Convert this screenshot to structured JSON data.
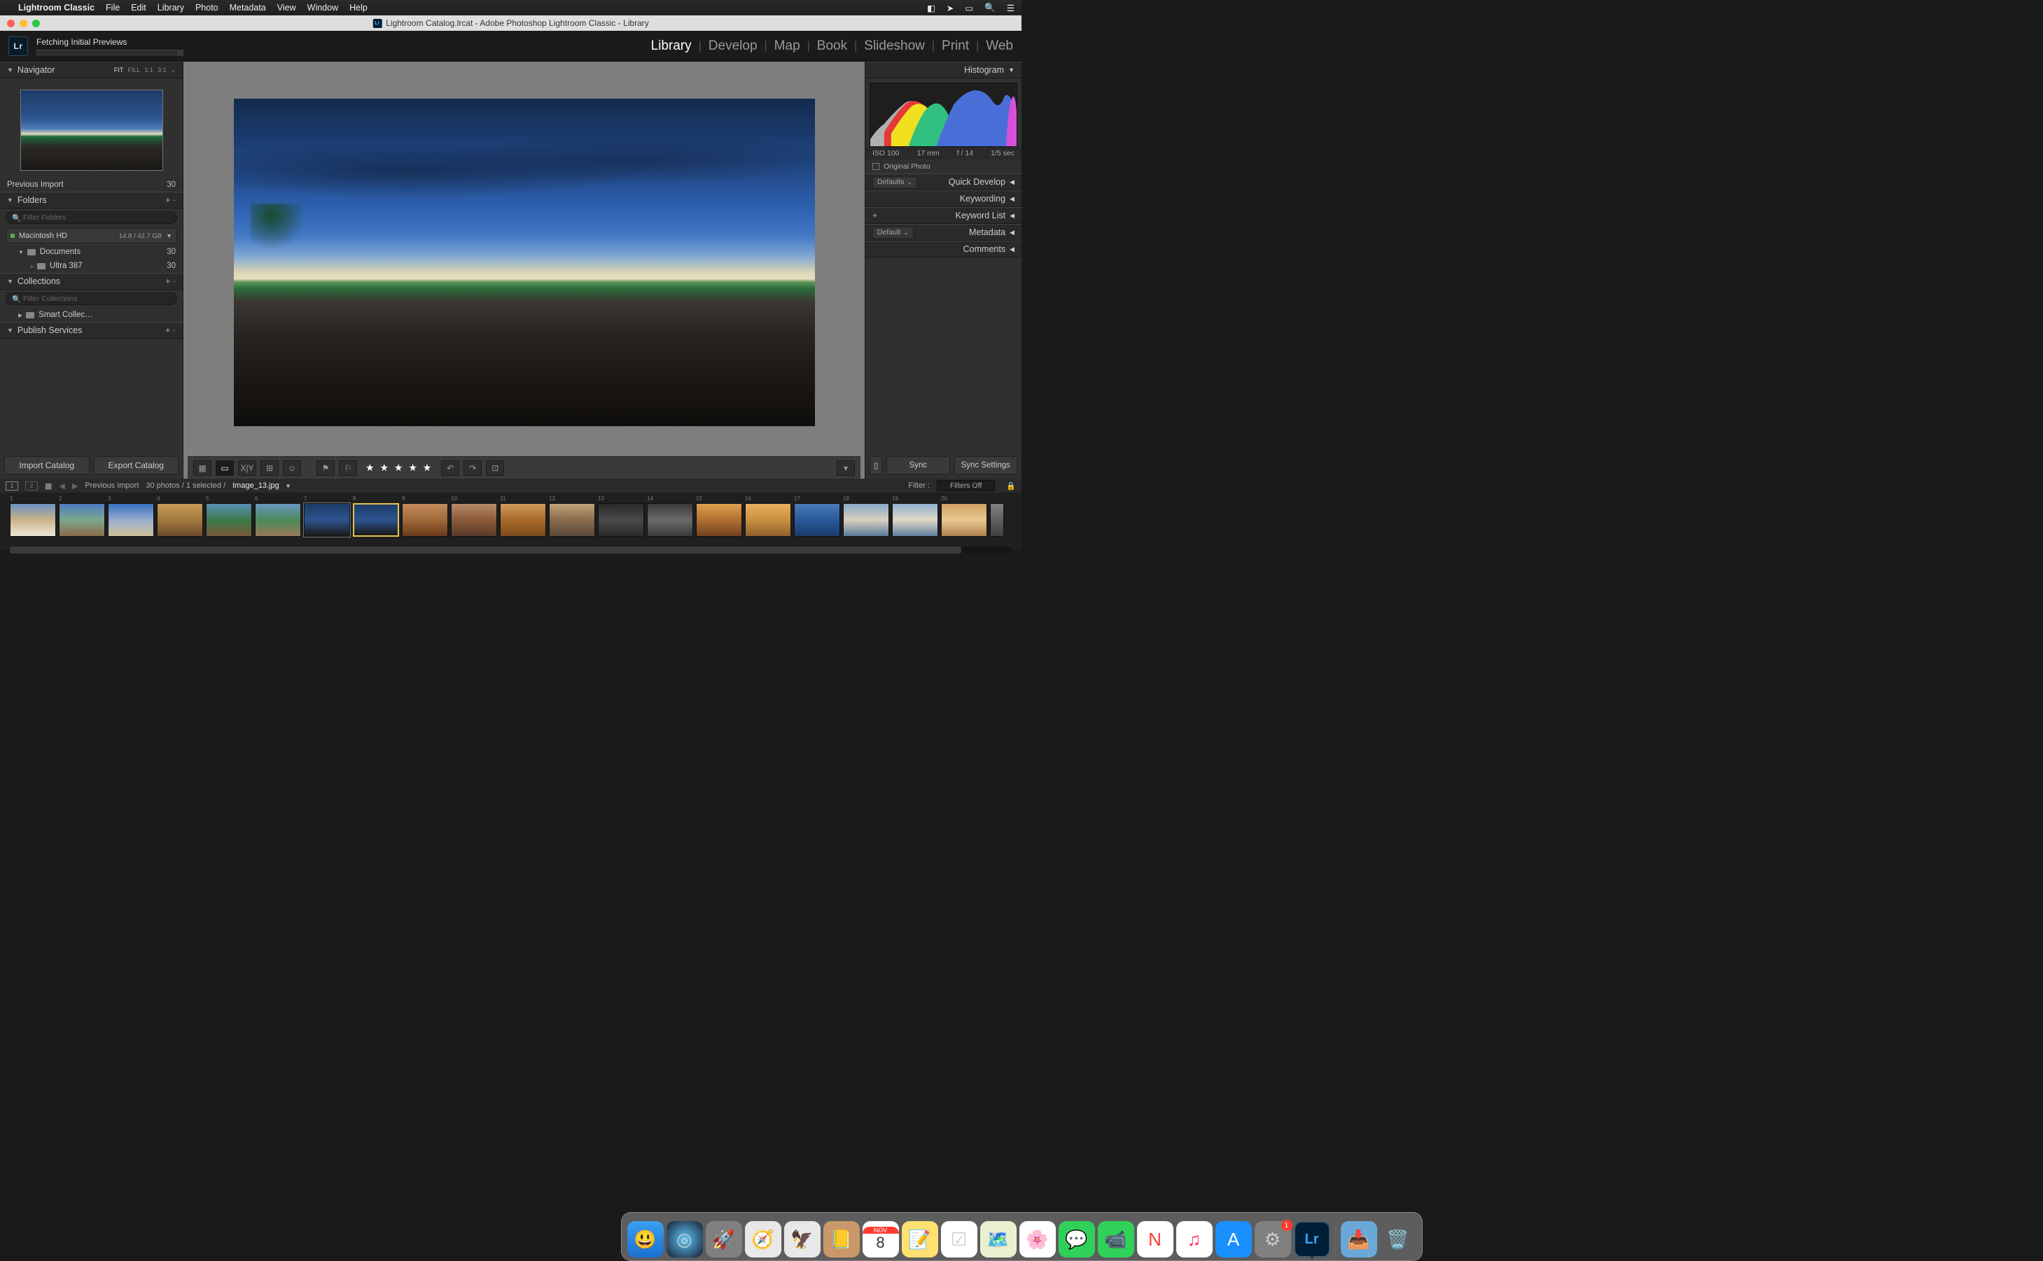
{
  "menubar": {
    "apple": "",
    "app": "Lightroom Classic",
    "items": [
      "File",
      "Edit",
      "Library",
      "Photo",
      "Metadata",
      "View",
      "Window",
      "Help"
    ]
  },
  "window": {
    "title": "Lightroom Catalog.lrcat - Adobe Photoshop Lightroom Classic - Library"
  },
  "topbar": {
    "logo": "Lr",
    "status": "Fetching Initial Previews",
    "modules": [
      "Library",
      "Develop",
      "Map",
      "Book",
      "Slideshow",
      "Print",
      "Web"
    ],
    "active_module": "Library"
  },
  "navigator": {
    "title": "Navigator",
    "opts": [
      "FIT",
      "FILL",
      "1:1",
      "3:1"
    ],
    "active_opt": "FIT"
  },
  "catalog_row": {
    "label": "Previous Import",
    "count": "30"
  },
  "folders": {
    "title": "Folders",
    "filter_placeholder": "Filter Folders",
    "volume": {
      "name": "Macintosh HD",
      "size": "14.8 / 42.7 GB"
    },
    "items": [
      {
        "name": "Documents",
        "count": "30"
      },
      {
        "name": "Ultra 387",
        "count": "30"
      }
    ]
  },
  "collections": {
    "title": "Collections",
    "filter_placeholder": "Filter Collections",
    "item": "Smart Collec…"
  },
  "publish": {
    "title": "Publish Services"
  },
  "left_buttons": {
    "import": "Import Catalog",
    "export": "Export Catalog"
  },
  "histogram": {
    "title": "Histogram",
    "iso": "ISO 100",
    "focal": "17 mm",
    "aperture": "f / 14",
    "shutter": "1/5 sec",
    "original": "Original Photo"
  },
  "right_panels": {
    "defaults1": "Defaults",
    "quick_develop": "Quick Develop",
    "keywording": "Keywording",
    "keyword_list": "Keyword List",
    "default2": "Default",
    "metadata": "Metadata",
    "comments": "Comments"
  },
  "sync": {
    "sync": "Sync",
    "settings": "Sync Settings"
  },
  "toolbar": {
    "stars": "★ ★ ★ ★ ★"
  },
  "filmstrip_bar": {
    "monitor1": "1",
    "monitor2": "2",
    "source": "Previous Import",
    "counts": "30 photos / 1 selected /",
    "filename": "Image_13.jpg",
    "filter_label": "Filter :",
    "filters_off": "Filters Off"
  },
  "filmstrip": {
    "numbers": [
      "1",
      "2",
      "3",
      "4",
      "5",
      "6",
      "7",
      "8",
      "9",
      "10",
      "11",
      "12",
      "13",
      "14",
      "15",
      "16",
      "17",
      "18",
      "19",
      "20"
    ],
    "selected_index": 7,
    "adjacent_index": 6
  },
  "dock": {
    "badge": "1",
    "cal_month": "NOV",
    "cal_day": "8"
  }
}
